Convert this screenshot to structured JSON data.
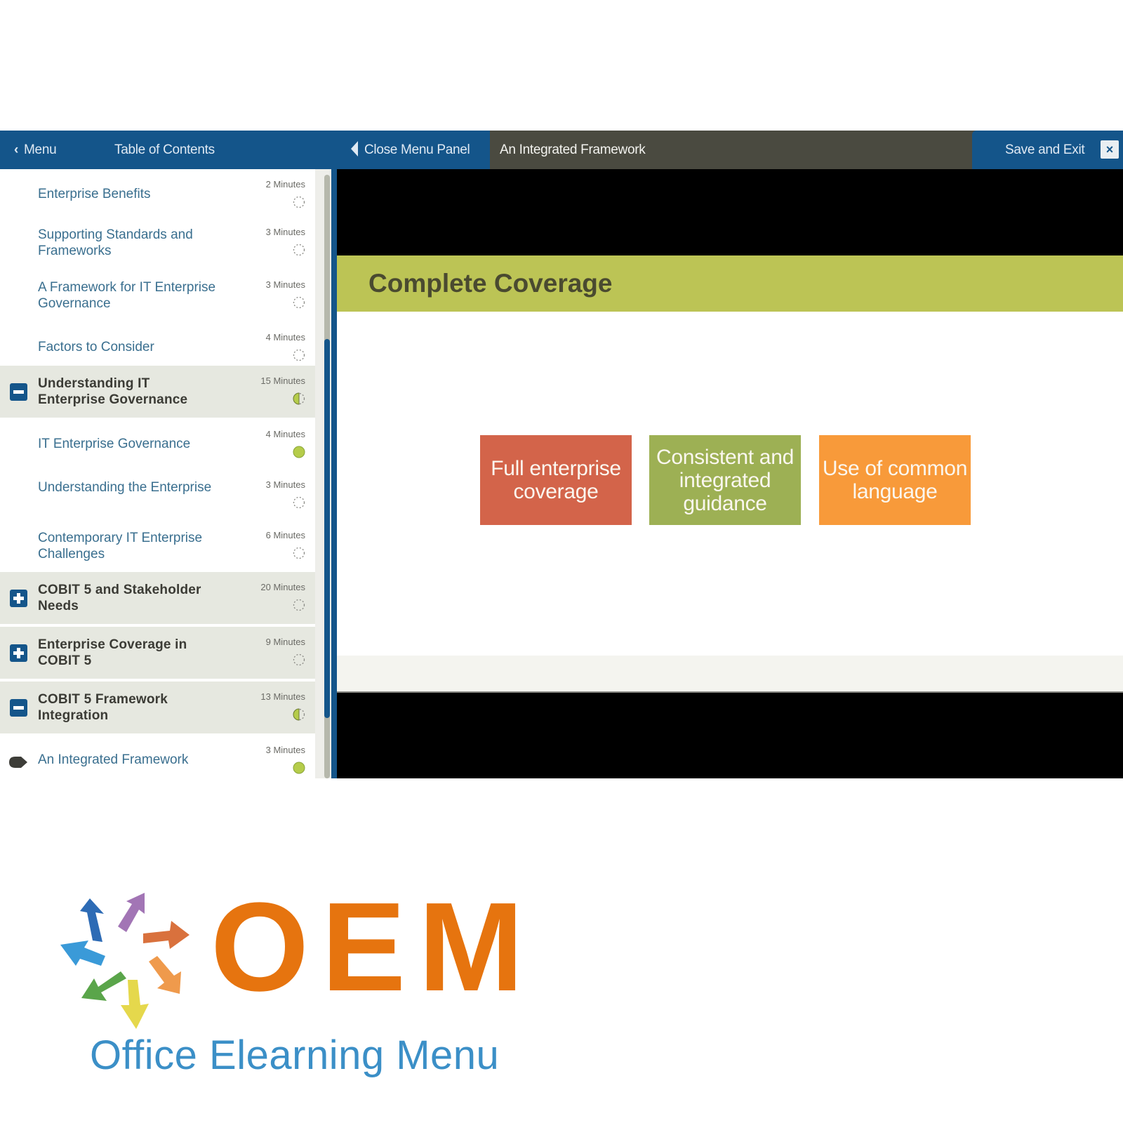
{
  "topbar": {
    "menu_label": "Menu",
    "toc_label": "Table of Contents",
    "close_panel_label": "Close Menu Panel",
    "lesson_title": "An Integrated Framework",
    "save_exit_label": "Save and Exit",
    "close_icon": "×"
  },
  "toc": {
    "items": [
      {
        "title": "Enterprise Benefits",
        "duration": "2 Minutes",
        "type": "topic",
        "status": "not-started"
      },
      {
        "title": "Supporting Standards and Frameworks",
        "duration": "3 Minutes",
        "type": "topic",
        "status": "not-started"
      },
      {
        "title": "A Framework for IT Enterprise Governance",
        "duration": "3 Minutes",
        "type": "topic",
        "status": "not-started"
      },
      {
        "title": "Factors to Consider",
        "duration": "4 Minutes",
        "type": "topic",
        "status": "not-started"
      },
      {
        "title": "Understanding IT Enterprise Governance",
        "duration": "15 Minutes",
        "type": "section",
        "expanded": true,
        "status": "partial"
      },
      {
        "title": "IT Enterprise Governance",
        "duration": "4 Minutes",
        "type": "topic",
        "status": "complete"
      },
      {
        "title": "Understanding the Enterprise",
        "duration": "3 Minutes",
        "type": "topic",
        "status": "not-started"
      },
      {
        "title": "Contemporary IT Enterprise Challenges",
        "duration": "6 Minutes",
        "type": "topic",
        "status": "not-started"
      },
      {
        "title": "COBIT 5 and Stakeholder Needs",
        "duration": "20 Minutes",
        "type": "section",
        "expanded": false,
        "status": "not-started"
      },
      {
        "title": "Enterprise Coverage in COBIT 5",
        "duration": "9 Minutes",
        "type": "section",
        "expanded": false,
        "status": "not-started"
      },
      {
        "title": "COBIT 5 Framework Integration",
        "duration": "13 Minutes",
        "type": "section",
        "expanded": true,
        "status": "partial"
      },
      {
        "title": "An Integrated Framework",
        "duration": "3 Minutes",
        "type": "topic",
        "status": "complete",
        "current": true
      }
    ]
  },
  "slide": {
    "title": "Complete Coverage",
    "boxes": [
      {
        "text": "Full enterprise coverage",
        "color": "#d3644a"
      },
      {
        "text": "Consistent and integrated guidance",
        "color": "#9db054"
      },
      {
        "text": "Use of common language",
        "color": "#f89a3a"
      }
    ]
  },
  "colors": {
    "brand_blue": "#14558a",
    "status_green": "#b5cc4a",
    "slide_title_bar": "#bcc455"
  },
  "logo": {
    "wordmark": "OEM",
    "tagline": "Office Elearning Menu"
  }
}
